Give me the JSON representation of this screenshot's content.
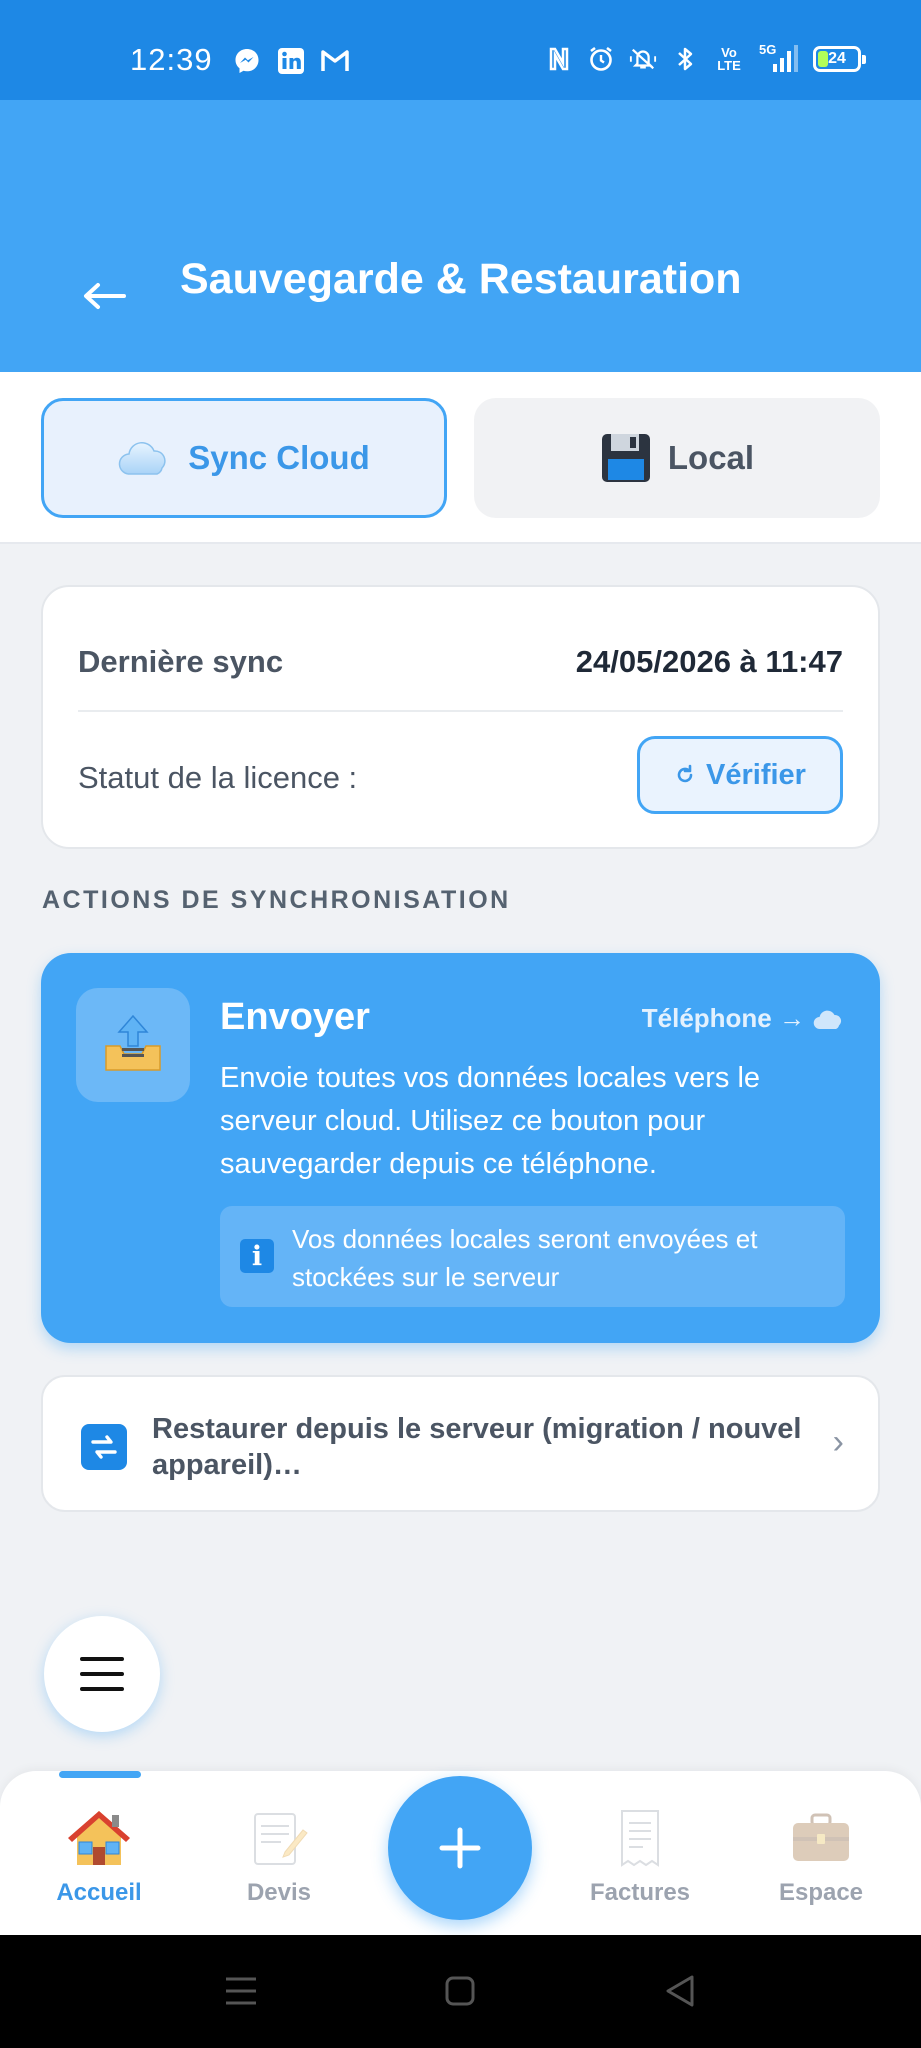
{
  "status_bar": {
    "time": "12:39",
    "apps": [
      "messenger-icon",
      "linkedin-icon",
      "gmail-icon"
    ],
    "network_top": "Vo",
    "network_bottom": "LTE",
    "signal_label": "5G",
    "battery": "24",
    "battery_level": 0.24
  },
  "header": {
    "back_icon": "arrow-left-icon",
    "title": "Sauvegarde & Restauration",
    "background": "#42a5f5"
  },
  "tabs": [
    {
      "label": "Sync Cloud",
      "icon": "cloud-icon",
      "active": true
    },
    {
      "label": "Local",
      "icon": "floppy-disk-icon",
      "active": false
    }
  ],
  "info_card": {
    "last_sync_label": "Dernière sync",
    "last_sync_value": "24/05/2026 à 11:47",
    "license_label": "Statut de la licence :",
    "verify_label": "Vérifier",
    "verify_icon": "refresh-icon"
  },
  "section_title": "ACTIONS DE SYNCHRONISATION",
  "send_card": {
    "icon": "upload-tray-icon",
    "title": "Envoyer",
    "route": "Téléphone →",
    "route_icon": "cloud-icon",
    "description": "Envoie toutes vos données locales vers le serveur cloud. Utilisez ce bouton pour sauvegarder depuis ce téléphone.",
    "note_icon": "info-icon",
    "note": "Vos données locales seront envoyées et stockées sur le serveur"
  },
  "restore_row": {
    "icon": "sync-arrows-icon",
    "label": "Restaurer depuis le serveur (migration / nouvel appareil)…",
    "chevron": "›"
  },
  "menu_fab": {
    "icon": "hamburger-menu-icon"
  },
  "bottom_nav": {
    "items": [
      {
        "label": "Accueil",
        "icon": "house-icon",
        "active": true
      },
      {
        "label": "Devis",
        "icon": "memo-icon",
        "active": false
      },
      {
        "label": "Factures",
        "icon": "receipt-icon",
        "active": false
      },
      {
        "label": "Espace",
        "icon": "briefcase-icon",
        "active": false
      }
    ],
    "add_icon": "plus-icon",
    "accent": "#42a5f5"
  },
  "system_nav": [
    "menu-icon",
    "home-square-icon",
    "back-triangle-icon"
  ]
}
